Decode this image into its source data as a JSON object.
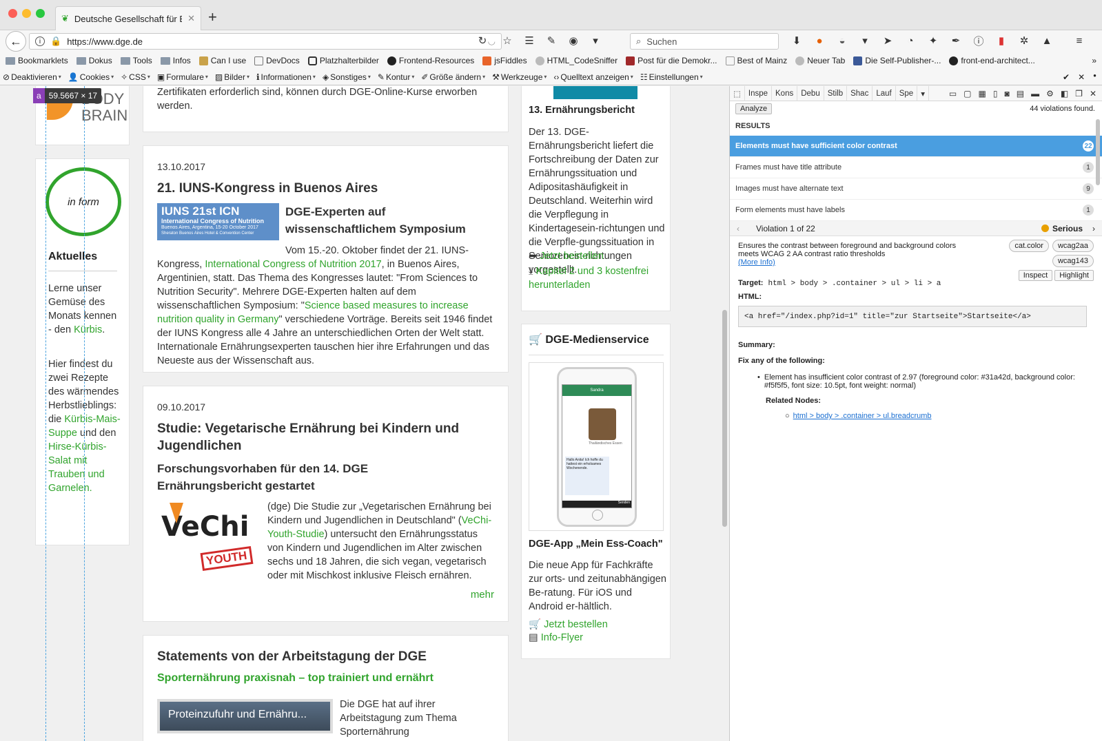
{
  "browser": {
    "tab_title": "Deutsche Gesellschaft für Ern",
    "url": "https://www.dge.de",
    "search_placeholder": "Suchen",
    "new_tab": "+"
  },
  "bookmarks": [
    "Bookmarklets",
    "Dokus",
    "Tools",
    "Infos",
    "Can I use",
    "DevDocs",
    "Platzhalterbilder",
    "Frontend-Resources",
    "jsFiddles",
    "HTML_CodeSniffer",
    "Post für die Demokr...",
    "Best of Mainz",
    "Neuer Tab",
    "Die Self-Publisher-...",
    "front-end-architect..."
  ],
  "webdev_toolbar": [
    "Deaktivieren",
    "Cookies",
    "CSS",
    "Formulare",
    "Bilder",
    "Informationen",
    "Sonstiges",
    "Kontur",
    "Größe ändern",
    "Werkzeuge",
    "Quelltext anzeigen",
    "Einstellungen"
  ],
  "ruler_badge": {
    "tag": "a",
    "size": "59.5667 × 17"
  },
  "sidebar": {
    "logo_text": [
      "BODY",
      "BRAIN"
    ],
    "inform_text": "in form",
    "heading": "Aktuelles",
    "p1_a": "Lerne unser Gemüse des Monats kennen - den ",
    "p1_link": "Kürbis",
    "p1_b": ".",
    "p2_a": "Hier findest du zwei Rezepte des wärmendes Herbstlieblings: die ",
    "p2_link1": "Kürbis-Mais-Suppe",
    "p2_b": " und den ",
    "p2_link2": "Hirse-Kürbis-Salat mit Trauben und Garnelen."
  },
  "main": {
    "top_text": "Zertifikaten erforderlich sind, können durch DGE-Online-Kurse erworben werden.",
    "article1": {
      "date": "13.10.2017",
      "title": "21. IUNS-Kongress in Buenos Aires",
      "image_title": "IUNS 21st ICN",
      "image_sub": "International Congress of Nutrition",
      "image_sub2": "Buenos Aires, Argentina, 15-20 October 2017",
      "image_sub3": "Sheraton Buenos Aires Hotel & Convention Center",
      "subtitle": "DGE-Experten auf wissenschaftlichem Symposium",
      "text_a": "Vom 15.-20. Oktober findet der 21. IUNS-Kongress, ",
      "link1": "International Congress of Nutrition 2017",
      "text_b": ", in Buenos Aires, Argentinien, statt. Das Thema des Kongresses lautet: \"From Sciences to Nutrition Security\". Mehrere DGE-Experten halten auf dem wissenschaftlichen Symposium: \"",
      "link2": "Science based measures to increase nutrition quality in Germany",
      "text_c": "\" verschiedene Vorträge. Bereits seit 1946 findet der IUNS Kongress alle 4 Jahre an unterschiedlichen Orten der Welt statt. Internationale Ernährungsexperten tauschen hier ihre Erfahrungen und das Neueste aus der Wissenschaft aus."
    },
    "article2": {
      "date": "09.10.2017",
      "title": "Studie: Vegetarische Ernährung bei Kindern und Jugendlichen",
      "subtitle": "Forschungsvorhaben für den 14. DGE Ernährungsbericht gestartet",
      "logo_text": "VeChi",
      "logo_youth": "YOUTH",
      "text_a": "(dge) Die Studie zur „Vegetarischen Ernährung bei Kindern und Jugendlichen in Deutschland\" (",
      "link": "VeChi-Youth-Studie",
      "text_b": ") untersucht den Ernährungsstatus von Kindern und Jugendlichen im Alter zwischen sechs und 18 Jahren, die sich vegan, vegetarisch oder mit Mischkost inklusive Fleisch ernähren.",
      "more": "mehr"
    },
    "article3": {
      "title": "Statements von der Arbeitstagung der DGE",
      "subtitle": "Sporternährung praxisnah – top trainiert und ernährt",
      "video_title": "Proteinzufuhr und Ernähru...",
      "text": "Die DGE hat auf ihrer Arbeitstagung zum Thema Sporternährung"
    }
  },
  "right_col": {
    "report_title": "13. Ernährungsbericht",
    "report_text": "Der 13. DGE-Ernährungsbericht liefert die Fortschreibung der Daten zur Ernährungssituation und Adipositashäufigkeit in Deutschland. Weiterhin wird die Verpflegung in Kindertagesein-richtungen und die Verpfle-gungssituation in Seniorenein-richtungen vorgestellt.",
    "link_order": "Jetzt bestellen",
    "link_download": "Kapitel 2 und 3 kostenfrei herunterladen",
    "media_title": "DGE-Medienservice",
    "phone_contact": "Sandra",
    "phone_photo_caption": "Thailändisches Essen",
    "phone_msg": "Hallo Anita! Ich hoffe du hattest ein erholsames Wochenende.",
    "phone_send": "Senden",
    "app_title": "DGE-App „Mein Ess-Coach\"",
    "app_text": "Die neue App für Fachkräfte zur orts- und zeitunabhängigen Be-ratung. Für iOS und Android er-hältlich.",
    "app_link1": "Jetzt bestellen",
    "app_link2": "Info-Flyer"
  },
  "devtools": {
    "tabs": [
      "Inspe",
      "Kons",
      "Debu",
      "Stilb",
      "Shac",
      "Lauf",
      "Spe"
    ],
    "analyze": "Analyze",
    "violations_found": "44 violations found.",
    "results_label": "RESULTS",
    "results": [
      {
        "label": "Elements must have sufficient color contrast",
        "count": "22"
      },
      {
        "label": "Frames must have title attribute",
        "count": "1"
      },
      {
        "label": "Images must have alternate text",
        "count": "9"
      },
      {
        "label": "Form elements must have labels",
        "count": "1"
      }
    ],
    "violation_nav": "Violation 1 of 22",
    "severity": "Serious",
    "description": "Ensures the contrast between foreground and background colors meets WCAG 2 AA contrast ratio thresholds",
    "more_info": "(More Info)",
    "tags": [
      "cat.color",
      "wcag2aa",
      "wcag143"
    ],
    "inspect_btn": "Inspect",
    "highlight_btn": "Highlight",
    "target_label": "Target:",
    "target": "html > body > .container > ul > li > a",
    "html_label": "HTML:",
    "html_code": "<a href=\"/index.php?id=1\" title=\"zur Startseite\">Startseite</a>",
    "summary_label": "Summary:",
    "fix_label": "Fix any of the following:",
    "fix_item": "Element has insufficient color contrast of 2.97 (foreground color: #31a42d, background color: #f5f5f5, font size: 10.5pt, font weight: normal)",
    "related_label": "Related Nodes:",
    "related_node": "html > body > .container > ul.breadcrumb"
  },
  "colors": {
    "accent_green": "#31a42d",
    "selected_row": "#4a9ee0",
    "serious": "#e8a000",
    "ruler": "#4aa3df"
  }
}
